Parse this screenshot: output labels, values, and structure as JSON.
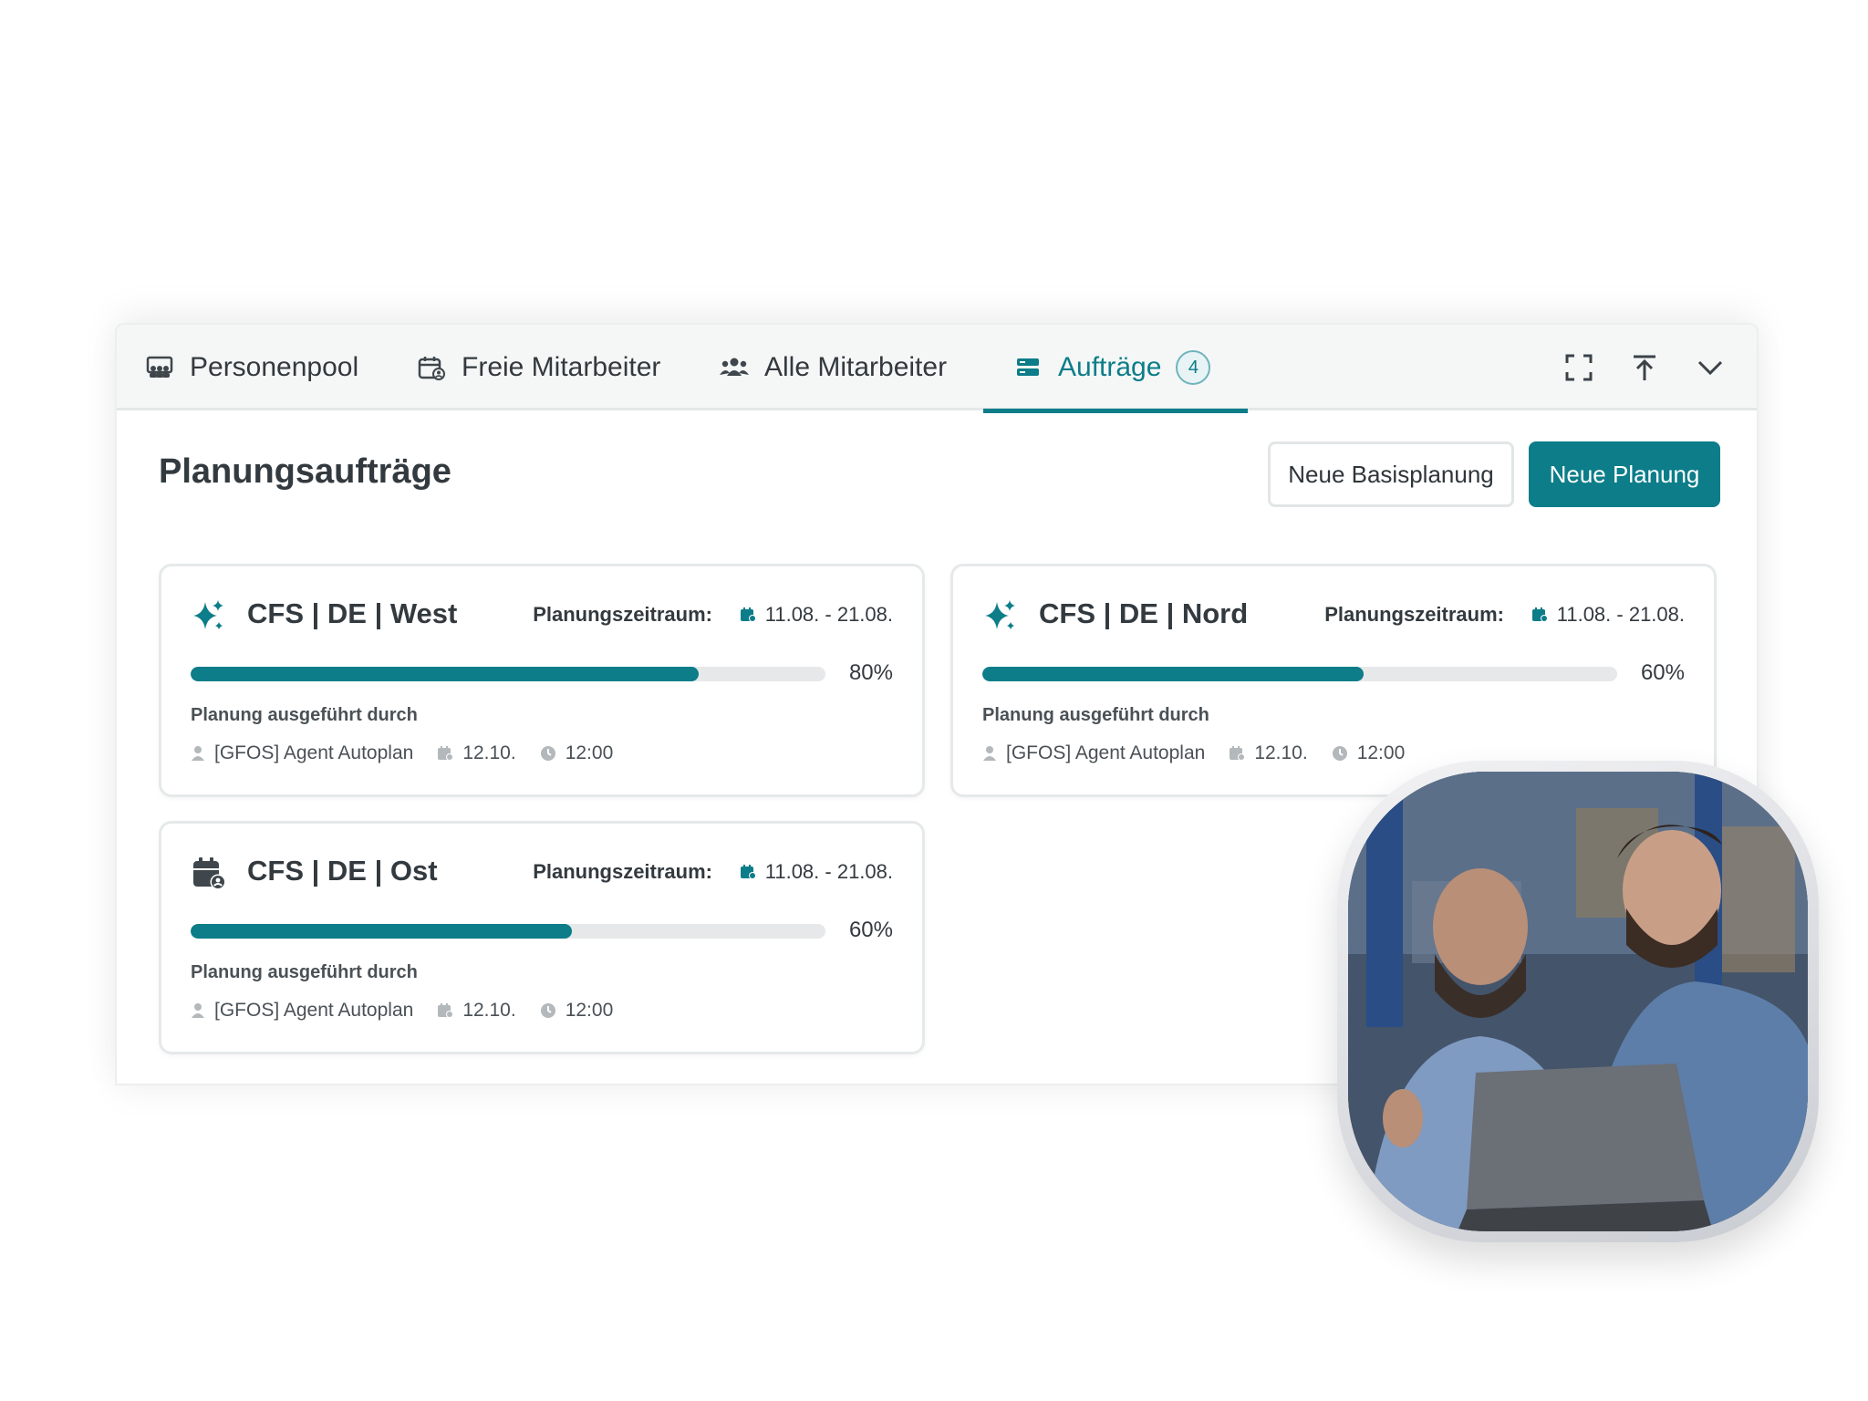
{
  "tabs": [
    {
      "label": "Personenpool",
      "icon": "person-pool-icon",
      "active": false
    },
    {
      "label": "Freie Mitarbeiter",
      "icon": "calendar-person-icon",
      "active": false
    },
    {
      "label": "Alle Mitarbeiter",
      "icon": "group-icon",
      "active": false
    },
    {
      "label": "Aufträge",
      "icon": "stack-icon",
      "active": true,
      "badge": "4"
    }
  ],
  "toolbar": [
    "fullscreen-icon",
    "collapse-up-icon",
    "chevron-down-icon"
  ],
  "page": {
    "title": "Planungsaufträge"
  },
  "buttons": {
    "secondary": "Neue Basisplanung",
    "primary": "Neue Planung"
  },
  "cards": [
    {
      "icon": "sparkle-icon",
      "title": "CFS | DE | West",
      "period_label": "Planungszeitraum:",
      "period": "11.08. - 21.08.",
      "progress": 0.8,
      "progress_text": "80%",
      "executed_label": "Planung ausgeführt durch",
      "agent": "[GFOS] Agent Autoplan",
      "date": "12.10.",
      "time": "12:00"
    },
    {
      "icon": "sparkle-icon",
      "title": "CFS | DE | Nord",
      "period_label": "Planungszeitraum:",
      "period": "11.08. - 21.08.",
      "progress": 0.6,
      "progress_text": "60%",
      "executed_label": "Planung ausgeführt durch",
      "agent": "[GFOS] Agent Autoplan",
      "date": "12.10.",
      "time": "12:00"
    },
    {
      "icon": "calendar-person-icon",
      "title": "CFS | DE | Ost",
      "period_label": "Planungszeitraum:",
      "period": "11.08. - 21.08.",
      "progress": 0.6,
      "progress_text": "60%",
      "executed_label": "Planung ausgeführt durch",
      "agent": "[GFOS] Agent Autoplan",
      "date": "12.10.",
      "time": "12:00"
    }
  ],
  "colors": {
    "accent": "#0c7d89",
    "text": "#333a3f",
    "track": "#e6e8e9"
  }
}
